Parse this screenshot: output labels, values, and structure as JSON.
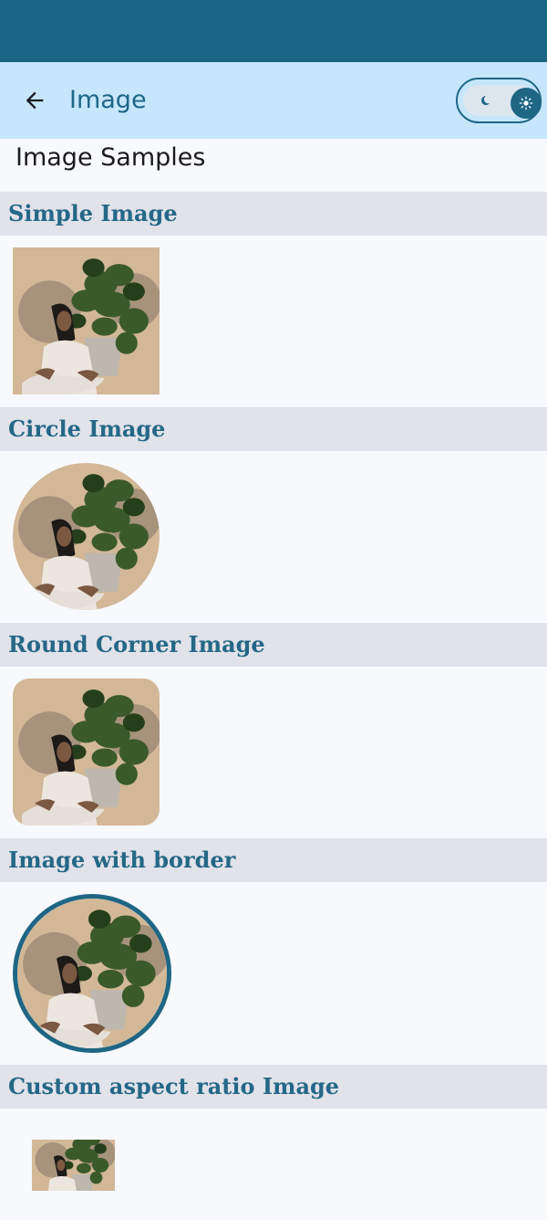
{
  "app_bar": {
    "title": "Image",
    "back_icon": "arrow-back-icon",
    "theme_toggle": {
      "light_icon": "sun-icon",
      "dark_icon": "moon-icon",
      "selected": "light"
    }
  },
  "page_heading": "Image Samples",
  "sections": [
    {
      "title": "Simple Image"
    },
    {
      "title": "Circle Image"
    },
    {
      "title": "Round Corner Image"
    },
    {
      "title": "Image with border"
    },
    {
      "title": "Custom aspect ratio Image"
    }
  ],
  "colors": {
    "status_bar": "#1a6584",
    "app_bar": "#c6e6fb",
    "accent": "#1f6685",
    "section_bg": "#e1e2ea",
    "background": "#f8f9fd"
  }
}
